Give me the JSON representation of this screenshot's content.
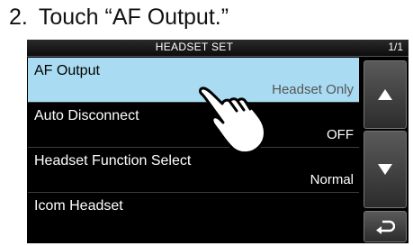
{
  "instruction": {
    "number": "2.",
    "text": "Touch “AF Output.”"
  },
  "screen": {
    "title": "HEADSET SET",
    "page": "1/1",
    "items": [
      {
        "label": "AF Output",
        "value": "Headset Only"
      },
      {
        "label": "Auto Disconnect",
        "value": "OFF"
      },
      {
        "label": "Headset Function Select",
        "value": "Normal"
      },
      {
        "label": "Icom Headset",
        "value": ""
      }
    ]
  },
  "icons": {
    "up": "triangle-up-icon",
    "down": "triangle-down-icon",
    "back": "return-arrow-icon",
    "pointer": "touch-hand-icon"
  },
  "colors": {
    "selected_row": "#a9dcf2",
    "screen_bg": "#000000"
  }
}
